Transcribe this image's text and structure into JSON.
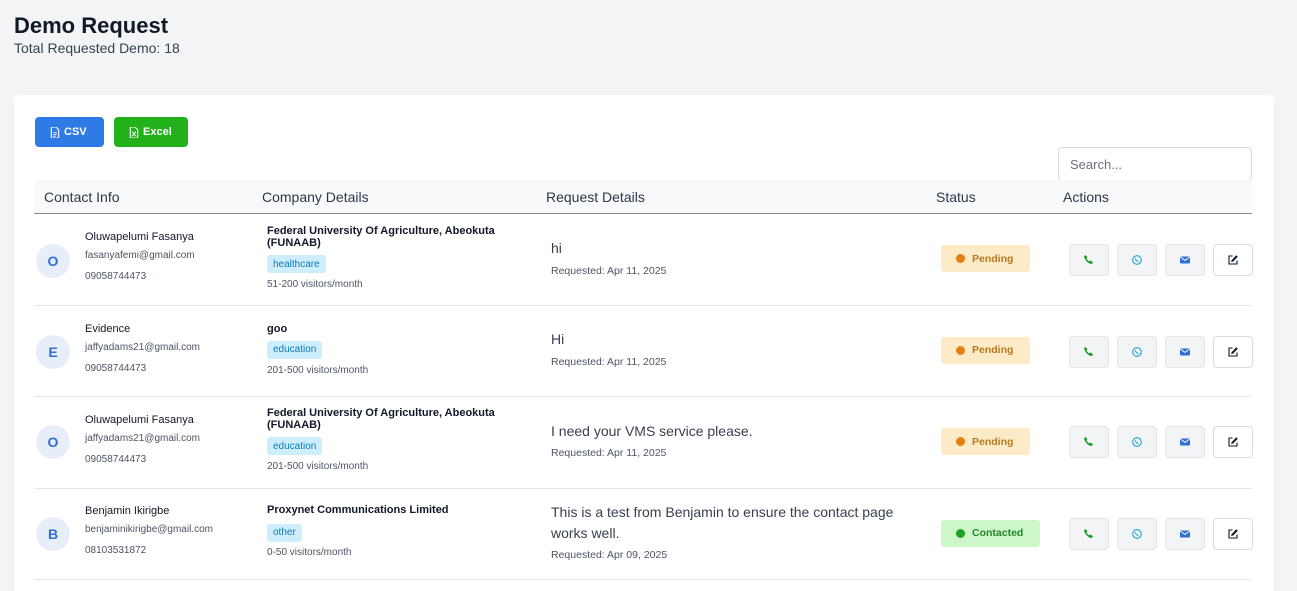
{
  "page": {
    "title": "Demo Request",
    "subtitle": "Total Requested Demo: 18"
  },
  "toolbar": {
    "csv_label": "CSV",
    "excel_label": "Excel",
    "search_placeholder": "Search..."
  },
  "table": {
    "headers": {
      "contact": "Contact Info",
      "company": "Company Details",
      "request": "Request Details",
      "status": "Status",
      "actions": "Actions"
    },
    "rows": [
      {
        "initial": "O",
        "name": "Oluwapelumi Fasanya",
        "email": "fasanyafemi@gmail.com",
        "phone": "09058744473",
        "company": "Federal University Of Agriculture, Abeokuta (FUNAAB)",
        "industry": "healthcare",
        "visitors": "51-200 visitors/month",
        "message": "hi",
        "requested": "Requested: Apr 11, 2025",
        "status": "Pending"
      },
      {
        "initial": "E",
        "name": "Evidence",
        "email": "jaffyadams21@gmail.com",
        "phone": "09058744473",
        "company": "goo",
        "industry": "education",
        "visitors": "201-500 visitors/month",
        "message": "Hi",
        "requested": "Requested: Apr 11, 2025",
        "status": "Pending"
      },
      {
        "initial": "O",
        "name": "Oluwapelumi Fasanya",
        "email": "jaffyadams21@gmail.com",
        "phone": "09058744473",
        "company": "Federal University Of Agriculture, Abeokuta (FUNAAB)",
        "industry": "education",
        "visitors": "201-500 visitors/month",
        "message": "I need your VMS service please.",
        "requested": "Requested: Apr 11, 2025",
        "status": "Pending"
      },
      {
        "initial": "B",
        "name": "Benjamin Ikirigbe",
        "email": "benjaminikirigbe@gmail.com",
        "phone": "08103531872",
        "company": "Proxynet Communications Limited",
        "industry": "other",
        "visitors": "0-50 visitors/month",
        "message": "This is a test from Benjamin to ensure the contact page works well.",
        "requested": "Requested: Apr 09, 2025",
        "status": "Contacted"
      }
    ]
  },
  "icons": {
    "csv": "file-icon",
    "excel": "spreadsheet-icon",
    "call": "phone-icon",
    "whatsapp": "whatsapp-icon",
    "email": "envelope-icon",
    "edit": "edit-icon"
  },
  "colors": {
    "primary": "#2f7be5",
    "success": "#22b11a",
    "pending": "#e57f14",
    "contacted": "#1aa322",
    "phone_icon": "#1f9d2a",
    "whatsapp_icon": "#1aa0d8",
    "email_icon": "#2f6fd6"
  }
}
